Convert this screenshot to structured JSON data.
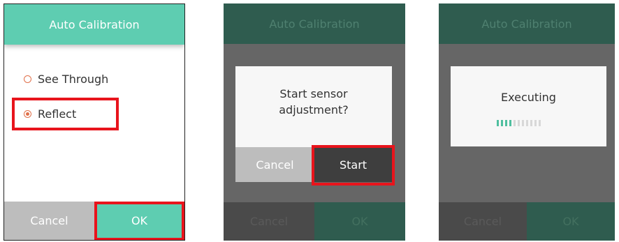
{
  "screen1": {
    "title": "Auto Calibration",
    "options": [
      {
        "label": "See Through",
        "selected": false
      },
      {
        "label": "Reflect",
        "selected": true
      }
    ],
    "cancel_label": "Cancel",
    "ok_label": "OK"
  },
  "screen2": {
    "title": "Auto Calibration",
    "dialog_message": "Start sensor adjustment?",
    "dialog_cancel_label": "Cancel",
    "dialog_start_label": "Start",
    "cancel_label": "Cancel",
    "ok_label": "OK"
  },
  "screen3": {
    "title": "Auto Calibration",
    "status_text": "Executing",
    "progress": {
      "filled": 4,
      "total": 11
    },
    "cancel_label": "Cancel",
    "ok_label": "OK"
  },
  "colors": {
    "accent": "#5ecdb1",
    "highlight": "#e8141c",
    "radio": "#e0704a",
    "progress_filled": "#4fbf9f",
    "progress_empty": "#d8d8d8"
  }
}
